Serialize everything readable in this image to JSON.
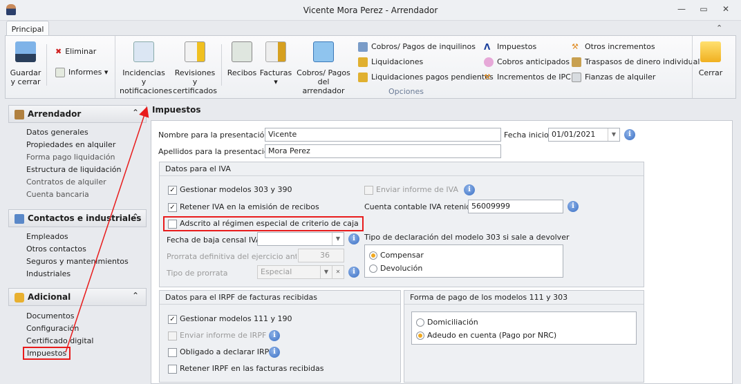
{
  "window": {
    "title": "Vicente Mora Perez - Arrendador",
    "minimize": "—",
    "restore": "▭",
    "close": "✕",
    "collapse_ribbon": "⌃"
  },
  "ribbon": {
    "tab": "Principal",
    "save_close": "Guardar y cerrar",
    "delete": "Eliminar",
    "reports": "Informes",
    "incidences": "Incidencias y notificaciones",
    "revisions": "Revisiones y certificados",
    "receipts": "Recibos",
    "invoices": "Facturas",
    "landlord_payments": "Cobros/ Pagos del arrendador",
    "options_group": "Opciones",
    "options": [
      [
        "Cobros/ Pagos de inquilinos",
        "Liquidaciones",
        "Liquidaciones pagos pendientes"
      ],
      [
        "Impuestos",
        "Cobros anticipados",
        "Incrementos de IPC"
      ],
      [
        "Otros incrementos",
        "Traspasos de dinero individual",
        "Fianzas de alquiler"
      ]
    ],
    "close": "Cerrar"
  },
  "sidebar": {
    "groups": [
      {
        "title": "Arrendador",
        "items": [
          "Datos generales",
          "Propiedades en alquiler",
          "Forma pago liquidación",
          "Estructura de liquidación",
          "Contratos de alquiler",
          "Cuenta bancaria"
        ]
      },
      {
        "title": "Contactos e industriales",
        "items": [
          "Empleados",
          "Otros contactos",
          "Seguros y mantenimientos",
          "Industriales"
        ]
      },
      {
        "title": "Adicional",
        "items": [
          "Documentos",
          "Configuración",
          "Certificado digital",
          "Impuestos"
        ]
      }
    ]
  },
  "panel": {
    "title": "Impuestos",
    "name_label": "Nombre para la presentación:",
    "name_value": "Vicente",
    "surname_label": "Apellidos para la presentación:",
    "surname_value": "Mora Perez",
    "start_date_label": "Fecha inicio:",
    "start_date_value": "01/01/2021",
    "iva": {
      "title": "Datos para el IVA",
      "manage_303": "Gestionar modelos 303 y 390",
      "retain_iva": "Retener IVA en la emisión de recibos",
      "cash_regime": "Adscrito al régimen especial de criterio de caja",
      "send_report": "Enviar informe de IVA",
      "account_label": "Cuenta contable IVA retenido:",
      "account_value": "56009999",
      "census_label": "Fecha de baja censal IVA",
      "census_value": "",
      "prorrata_label": "Prorrata definitiva del ejercicio anterior",
      "prorrata_value": "36",
      "prorrata_type_label": "Tipo de prorrata",
      "prorrata_type_value": "Especial",
      "decl_label": "Tipo de declaración del modelo 303 si sale a devolver",
      "decl_options": [
        "Compensar",
        "Devolución"
      ]
    },
    "irpf": {
      "title": "Datos para el IRPF de facturas recibidas",
      "manage_111": "Gestionar modelos 111 y 190",
      "send_report": "Enviar informe de IRPF",
      "obliged": "Obligado a declarar IRPF",
      "retain": "Retener IRPF en las facturas recibidas"
    },
    "payment": {
      "title": "Forma de pago de los modelos 111 y 303",
      "options": [
        "Domiciliación",
        "Adeudo en cuenta (Pago por NRC)"
      ]
    }
  }
}
